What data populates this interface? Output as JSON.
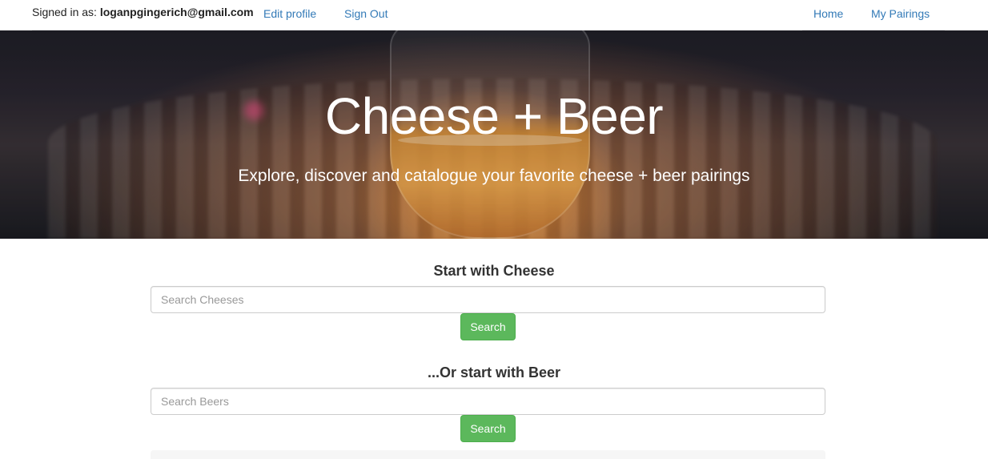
{
  "nav": {
    "signed_in_prefix": "Signed in as: ",
    "email": "loganpgingerich@gmail.com",
    "edit_profile": "Edit profile",
    "sign_out": "Sign Out",
    "home": "Home",
    "my_pairings": "My Pairings",
    "link_color": "#337ab7"
  },
  "hero": {
    "title": "Cheese + Beer",
    "subtitle": "Explore, discover and catalogue your favorite cheese + beer pairings"
  },
  "cheese": {
    "heading": "Start with Cheese",
    "placeholder": "Search Cheeses",
    "value": "",
    "button": "Search"
  },
  "beer": {
    "heading": "...Or start with Beer",
    "placeholder": "Search Beers",
    "value": "",
    "button": "Search"
  },
  "colors": {
    "button_green": "#5cb85c",
    "link_blue": "#337ab7"
  }
}
